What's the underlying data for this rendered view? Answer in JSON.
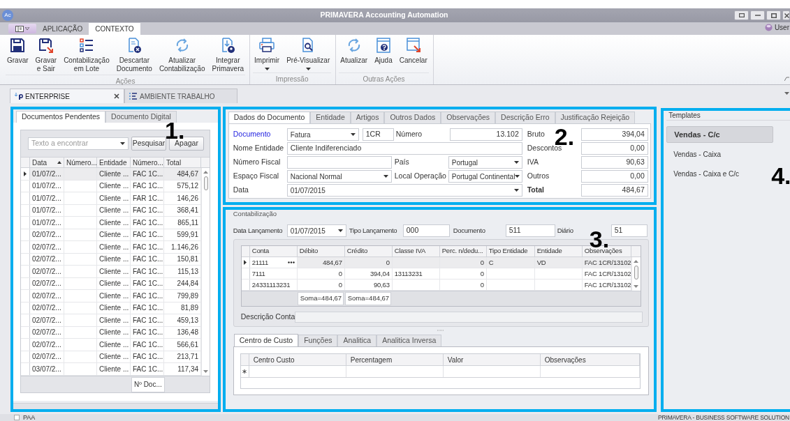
{
  "window": {
    "logo": "Ac",
    "title": "PRIMAVERA Accounting Automation",
    "user": "User"
  },
  "ribbon_tabs": [
    {
      "label": "APLICAÇÃO",
      "selected": false
    },
    {
      "label": "CONTEXTO",
      "selected": true
    }
  ],
  "ribbon_groups": [
    {
      "label": "Ações",
      "buttons": [
        {
          "label": "Gravar",
          "kind": "save",
          "dropdown": false
        },
        {
          "label": "Gravar\ne Sair",
          "kind": "save_exit",
          "dropdown": false
        },
        {
          "label": "Contabilização\nem Lote",
          "kind": "batch",
          "dropdown": false
        },
        {
          "label": "Descartar\nDocumento",
          "kind": "discard",
          "dropdown": false
        },
        {
          "label": "Atualizar\nContabilização",
          "kind": "refresh",
          "dropdown": false
        },
        {
          "label": "Integrar\nPrimavera",
          "kind": "integrate",
          "dropdown": false
        }
      ]
    },
    {
      "label": "Impressão",
      "buttons": [
        {
          "label": "Imprimir",
          "kind": "print",
          "dropdown": true
        },
        {
          "label": "Pré-Visualizar",
          "kind": "preview",
          "dropdown": true
        }
      ]
    },
    {
      "label": "Outras Ações",
      "buttons": [
        {
          "label": "Atualizar",
          "kind": "refresh",
          "dropdown": false
        },
        {
          "label": "Ajuda",
          "kind": "help",
          "dropdown": false
        },
        {
          "label": "Cancelar",
          "kind": "cancel",
          "dropdown": false
        }
      ]
    }
  ],
  "document_tabs": [
    {
      "label": "ENTERPRISE",
      "selected": true,
      "closable": true
    },
    {
      "label": "AMBIENTE TRABALHO",
      "selected": false,
      "closable": false
    }
  ],
  "pending_panel": {
    "callout": "1.",
    "tabs": [
      {
        "label": "Documentos Pendentes",
        "selected": true
      },
      {
        "label": "Documento Digital",
        "selected": false
      }
    ],
    "search": {
      "placeholder": "Texto a encontrar"
    },
    "buttons": [
      "Pesquisar",
      "Apagar"
    ],
    "table": {
      "columns": [
        {
          "label": "Data",
          "sorted": true
        },
        {
          "label": "Número..."
        },
        {
          "label": "Entidade"
        },
        {
          "label": "Número..."
        },
        {
          "label": "Total"
        }
      ],
      "rows": [
        {
          "date": "01/07/2...",
          "entity": "Cliente ...",
          "document": "FAC 1C...",
          "total": "484,67",
          "selected": true
        },
        {
          "date": "01/07/2...",
          "entity": "Cliente ...",
          "document": "FAC 1C...",
          "total": "575,12",
          "selected": false
        },
        {
          "date": "01/07/2...",
          "entity": "Cliente ...",
          "document": "FAR 1C...",
          "total": "146,26",
          "selected": false
        },
        {
          "date": "01/07/2...",
          "entity": "Cliente ...",
          "document": "FAC 1C...",
          "total": "368,41",
          "selected": false
        },
        {
          "date": "01/07/2...",
          "entity": "Cliente ...",
          "document": "FAC 1C...",
          "total": "865,11",
          "selected": false
        },
        {
          "date": "02/07/2...",
          "entity": "Cliente ...",
          "document": "FAC 1C...",
          "total": "599,91",
          "selected": false
        },
        {
          "date": "02/07/2...",
          "entity": "Cliente ...",
          "document": "FAC 1C...",
          "total": "1.146,26",
          "selected": false
        },
        {
          "date": "02/07/2...",
          "entity": "Cliente ...",
          "document": "FAC 1C...",
          "total": "150,81",
          "selected": false
        },
        {
          "date": "02/07/2...",
          "entity": "Cliente ...",
          "document": "FAC 1C...",
          "total": "115,13",
          "selected": false
        },
        {
          "date": "02/07/2...",
          "entity": "Cliente ...",
          "document": "FAC 1C...",
          "total": "244,84",
          "selected": false
        },
        {
          "date": "02/07/2...",
          "entity": "Cliente ...",
          "document": "FAC 1C...",
          "total": "799,89",
          "selected": false
        },
        {
          "date": "02/07/2...",
          "entity": "Cliente ...",
          "document": "FAC 1C...",
          "total": "81,89",
          "selected": false
        },
        {
          "date": "02/07/2...",
          "entity": "Cliente ...",
          "document": "FAC 1C...",
          "total": "459,13",
          "selected": false
        },
        {
          "date": "02/07/2...",
          "entity": "Cliente ...",
          "document": "FAC 1C...",
          "total": "136,48",
          "selected": false
        },
        {
          "date": "02/07/2...",
          "entity": "Cliente ...",
          "document": "FAC 1C...",
          "total": "566,61",
          "selected": false
        },
        {
          "date": "02/07/2...",
          "entity": "Cliente ...",
          "document": "FAC 1C...",
          "total": "213,71",
          "selected": false
        },
        {
          "date": "03/07/2...",
          "entity": "Cliente ...",
          "document": "FAC 1C...",
          "total": "117,34",
          "selected": false
        }
      ],
      "footer": "Nº Doc..."
    }
  },
  "document_panel": {
    "callout": "2.",
    "tabs": [
      {
        "label": "Dados do Documento",
        "selected": true
      },
      {
        "label": "Entidade",
        "selected": false
      },
      {
        "label": "Artigos",
        "selected": false
      },
      {
        "label": "Outros Dados",
        "selected": false
      },
      {
        "label": "Observações",
        "selected": false
      },
      {
        "label": "Descrição Erro",
        "selected": false
      },
      {
        "label": "Justificação Rejeição",
        "selected": false
      }
    ],
    "form": {
      "document": {
        "label": "Documento",
        "value": "Fatura"
      },
      "series": {
        "value": "1CR"
      },
      "number": {
        "label": "Número",
        "value": "13.102"
      },
      "entity_name": {
        "label": "Nome Entidade",
        "value": "Cliente Indiferenciado"
      },
      "tax_number": {
        "label": "Número Fiscal"
      },
      "country": {
        "label": "País",
        "value": "Portugal"
      },
      "tax_area": {
        "label": "Espaço Fiscal",
        "value": "Nacional Normal"
      },
      "operation_place": {
        "label": "Local Operação",
        "value": "Portugal Continental"
      },
      "date": {
        "label": "Data",
        "value": "01/07/2015"
      }
    },
    "totals": [
      {
        "label": "Bruto",
        "value": "394,04",
        "emphasis": false
      },
      {
        "label": "Descontos",
        "value": "0,00",
        "emphasis": false
      },
      {
        "label": "IVA",
        "value": "90,63",
        "emphasis": false
      },
      {
        "label": "Outros",
        "value": "0,00",
        "emphasis": false
      },
      {
        "label": "Total",
        "value": "484,67",
        "emphasis": true
      }
    ]
  },
  "accounting_panel": {
    "title": "Contabilização",
    "callout": "3.",
    "header": [
      {
        "label": "Data Lançamento",
        "value": "01/07/2015",
        "kind": "select"
      },
      {
        "label": "Tipo Lançamento",
        "value": "000",
        "kind": "field"
      },
      {
        "label": "Documento",
        "value": "511",
        "kind": "field"
      },
      {
        "label": "Diário",
        "value": "51",
        "kind": "field"
      }
    ],
    "table": {
      "columns": [
        "Conta",
        "Débito",
        "Crédito",
        "Classe IVA",
        "Perc. n/dedu...",
        "Tipo Entidade",
        "Entidade",
        "Observações"
      ],
      "rows": [
        {
          "account": "21111",
          "debit": "484,67",
          "credit": "0",
          "non_deductible": "0",
          "entity_type": "C",
          "entity": "VD",
          "notes": "FAC 1CR/13102",
          "selected": true
        },
        {
          "account": "7111",
          "debit": "0",
          "credit": "394,04",
          "vat_class": "13113231",
          "non_deductible": "0",
          "notes": "FAC 1CR/13102",
          "selected": false
        },
        {
          "account": "24331113231",
          "debit": "0",
          "credit": "90,63",
          "non_deductible": "0",
          "notes": "FAC 1CR/13102",
          "selected": false
        }
      ],
      "debit_sum": "Soma=484,67",
      "credit_sum": "Soma=484,67"
    },
    "account_description": {
      "label": "Descrição Conta"
    },
    "tabs": [
      {
        "label": "Centro de Custo",
        "selected": true
      },
      {
        "label": "Funções",
        "selected": false
      },
      {
        "label": "Analitica",
        "selected": false
      },
      {
        "label": "Analitica Inversa",
        "selected": false
      }
    ],
    "cost_table": {
      "columns": [
        "Centro Custo",
        "Percentagem",
        "Valor",
        "Observações"
      ]
    }
  },
  "templates_panel": {
    "title": "Templates",
    "callout": "4.",
    "items": [
      {
        "label": "Vendas - C/c",
        "selected": true
      },
      {
        "label": "Vendas - Caixa",
        "selected": false
      },
      {
        "label": "Vendas - Caixa e C/c",
        "selected": false
      }
    ]
  },
  "status_bar": {
    "left": "PAA",
    "right": "PRIMAVERA - BUSINESS SOFTWARE SOLUTION"
  }
}
